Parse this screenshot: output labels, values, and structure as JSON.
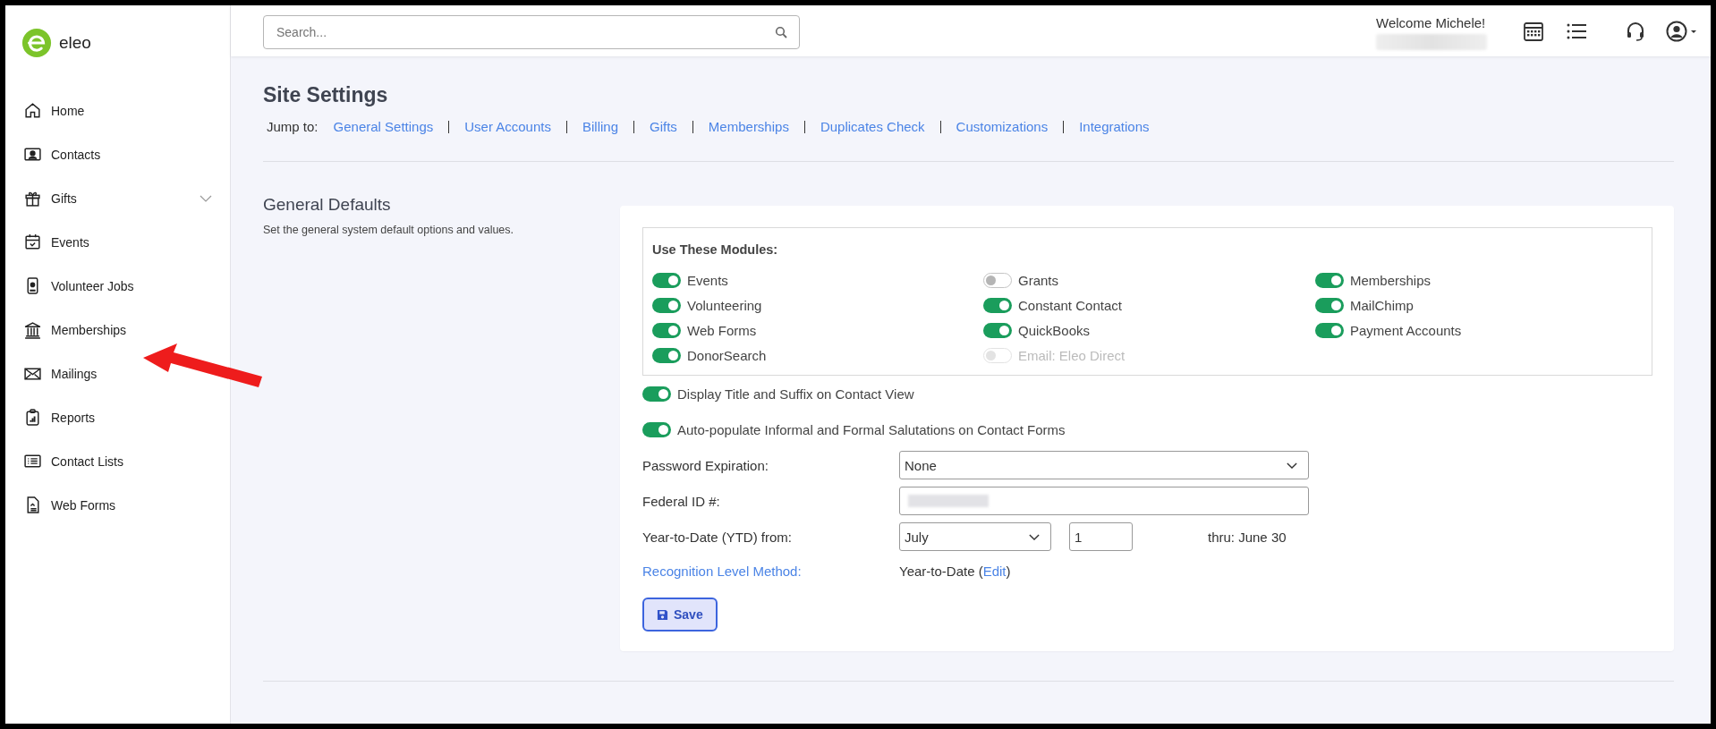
{
  "logo": {
    "text": "eleo"
  },
  "sidebar": {
    "items": [
      {
        "label": "Home",
        "kind": "link"
      },
      {
        "label": "Contacts",
        "kind": "link"
      },
      {
        "label": "Gifts",
        "kind": "group"
      },
      {
        "label": "Events",
        "kind": "link"
      },
      {
        "label": "Volunteer Jobs",
        "kind": "link"
      },
      {
        "label": "Memberships",
        "kind": "link"
      },
      {
        "label": "Mailings",
        "kind": "link"
      },
      {
        "label": "Reports",
        "kind": "link"
      },
      {
        "label": "Contact Lists",
        "kind": "link"
      },
      {
        "label": "Web Forms",
        "kind": "link"
      }
    ]
  },
  "header": {
    "search": {
      "placeholder": "Search..."
    },
    "welcome": "Welcome Michele!"
  },
  "page": {
    "title": "Site Settings",
    "jump_label": "Jump to:",
    "jump_links": [
      "General Settings",
      "User Accounts",
      "Billing",
      "Gifts",
      "Memberships",
      "Duplicates Check",
      "Customizations",
      "Integrations"
    ]
  },
  "section": {
    "title": "General Defaults",
    "description": "Set the general system default options and values."
  },
  "modules_title": "Use These Modules:",
  "modules": [
    {
      "label": "Events",
      "on": true,
      "disabled": false
    },
    {
      "label": "Volunteering",
      "on": true,
      "disabled": false
    },
    {
      "label": "Web Forms",
      "on": true,
      "disabled": false
    },
    {
      "label": "DonorSearch",
      "on": true,
      "disabled": false
    },
    {
      "label": "Grants",
      "on": false,
      "disabled": false
    },
    {
      "label": "Constant Contact",
      "on": true,
      "disabled": false
    },
    {
      "label": "QuickBooks",
      "on": true,
      "disabled": false
    },
    {
      "label": "Email: Eleo Direct",
      "on": false,
      "disabled": true
    },
    {
      "label": "Memberships",
      "on": true,
      "disabled": false
    },
    {
      "label": "MailChimp",
      "on": true,
      "disabled": false
    },
    {
      "label": "Payment Accounts",
      "on": true,
      "disabled": false
    }
  ],
  "options": [
    {
      "label": "Display Title and Suffix on Contact View",
      "on": true
    },
    {
      "label": "Auto-populate Informal and Formal Salutations on Contact Forms",
      "on": true
    }
  ],
  "form": {
    "password_label": "Password Expiration:",
    "password_value": "None",
    "federal_label": "Federal ID #:",
    "ytd_label": "Year-to-Date (YTD) from:",
    "ytd_month": "July",
    "ytd_day": "1",
    "ytd_thru": "thru: June 30",
    "recognition_label": "Recognition Level Method:",
    "recognition_prefix": "Year-to-Date (",
    "recognition_link": "Edit",
    "recognition_suffix": ")"
  },
  "save_button": "Save"
}
